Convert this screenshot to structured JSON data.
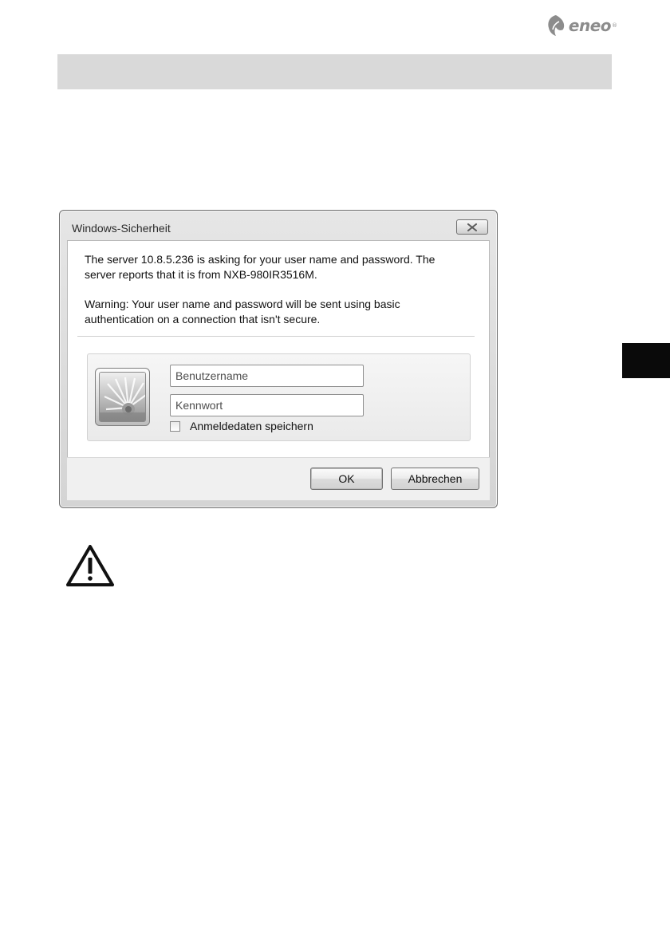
{
  "brand": {
    "name": "eneo",
    "registered_mark": "®",
    "icon": "eneo-leaf-logo",
    "color": "#8c8c8c"
  },
  "page": {
    "header_band_color": "#d9d9d9",
    "side_tab_color": "#0a0a0a"
  },
  "dialog": {
    "title": "Windows-Sicherheit",
    "close_icon": "close-x-icon",
    "message_1": "The server 10.8.5.236 is asking for your user name and password. The server reports that it is from NXB-980IR3516M.",
    "message_2": "Warning: Your user name and password will be sent using basic authentication on a connection that isn't secure.",
    "credentials": {
      "user_tile_icon": "user-account-picture",
      "username_placeholder": "Benutzername",
      "username_value": "",
      "password_placeholder": "Kennwort",
      "password_value": "",
      "remember_label": "Anmeldedaten speichern",
      "remember_checked": false
    },
    "buttons": {
      "ok": "OK",
      "cancel": "Abbrechen"
    }
  },
  "warning": {
    "icon": "warning-triangle-icon"
  }
}
